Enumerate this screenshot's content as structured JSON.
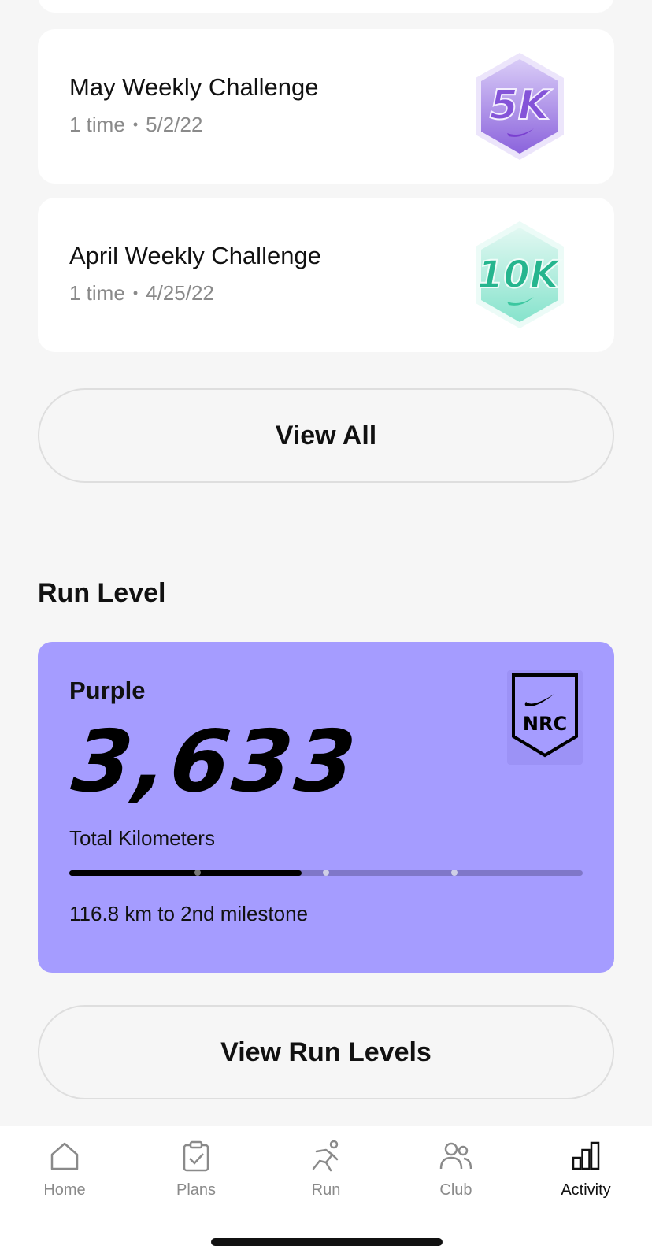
{
  "challenges": [
    {
      "title": "May Weekly Challenge",
      "count": "1 time",
      "date": "5/2/22",
      "badge_text": "5K",
      "badge_colors": {
        "top": "#c8b8f3",
        "bottom": "#7b55d4",
        "edge": "#e6dcfb",
        "text": "#8a5ad8"
      }
    },
    {
      "title": "April Weekly Challenge",
      "count": "1 time",
      "date": "4/25/22",
      "badge_text": "10K",
      "badge_colors": {
        "top": "#d8f6ee",
        "bottom": "#7fe0c8",
        "edge": "#e9fbf6",
        "text": "#2fbf98"
      }
    }
  ],
  "meta_separator": "•",
  "view_all_label": "View All",
  "run_level": {
    "section_title": "Run Level",
    "level_name": "Purple",
    "total_km": "3,633",
    "total_label": "Total Kilometers",
    "milestone_text": "116.8 km to 2nd milestone",
    "progress_fraction": 0.453,
    "milestone_ticks": [
      0.25,
      0.5,
      0.75
    ],
    "card_color": "#a59cff",
    "badge_text": "NRC"
  },
  "view_run_levels_label": "View Run Levels",
  "tabs": [
    {
      "label": "Home",
      "icon": "home-icon",
      "active": false
    },
    {
      "label": "Plans",
      "icon": "clipboard-check-icon",
      "active": false
    },
    {
      "label": "Run",
      "icon": "runner-icon",
      "active": false
    },
    {
      "label": "Club",
      "icon": "people-icon",
      "active": false
    },
    {
      "label": "Activity",
      "icon": "bar-chart-icon",
      "active": true
    }
  ]
}
